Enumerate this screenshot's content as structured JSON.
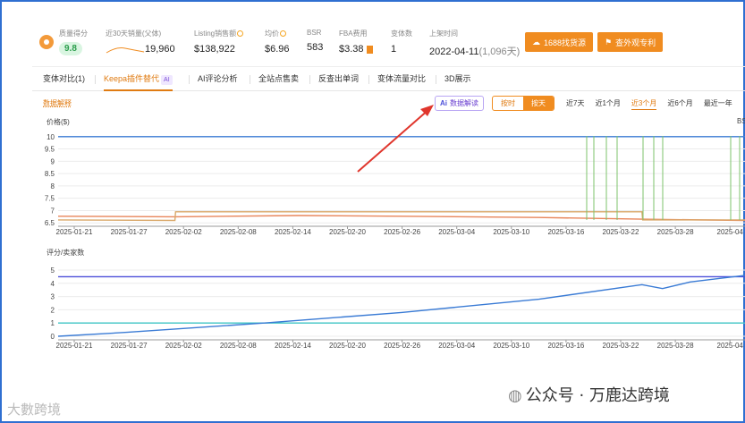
{
  "metrics": {
    "quality": {
      "label": "质量得分",
      "value": "9.8"
    },
    "sales30": {
      "label": "近30天销量(父体)",
      "value": "19,960"
    },
    "listing_sales": {
      "label": "Listing销售额",
      "value": "$138,922"
    },
    "avg_price": {
      "label": "均价",
      "value": "$6.96"
    },
    "bsr": {
      "label": "BSR",
      "value": "583"
    },
    "fba": {
      "label": "FBA费用",
      "value": "$3.38"
    },
    "variants": {
      "label": "变体数",
      "value": "1"
    },
    "launch": {
      "label": "上架时间",
      "value": "2022-04-11",
      "days": "(1,096天)"
    }
  },
  "buttons": {
    "find_source": "1688找货源",
    "patent": "查外观专利"
  },
  "tabs": [
    {
      "label": "变体对比(1)"
    },
    {
      "label": "Keepa插件替代",
      "badge": "AI"
    },
    {
      "label": "AI评论分析"
    },
    {
      "label": "全站点售卖"
    },
    {
      "label": "反查出单词"
    },
    {
      "label": "变体流量对比"
    },
    {
      "label": "3D展示"
    }
  ],
  "toolbar": {
    "interpret_link": "数据解释",
    "ai_button": "数据解读",
    "ai_prefix": "Ai",
    "hourly": "按时",
    "daily": "按天",
    "ranges": [
      "近7天",
      "近1个月",
      "近3个月",
      "近6个月",
      "最近一年"
    ]
  },
  "chart1": {
    "ylabel": "价格($)",
    "right_label": "BS"
  },
  "chart2": {
    "ylabel": "评分/卖家数"
  },
  "watermark": {
    "left": "大數跨境",
    "right": "公众号 · 万鹿达跨境"
  },
  "colors": {
    "accent": "#f08c20",
    "blue": "#3a7bd5",
    "green": "#7cc36b",
    "orange_line": "#e8855a",
    "purple": "#4b4fd9",
    "cyan": "#3ec6c6"
  },
  "chart_data": [
    {
      "type": "line",
      "ylabel": "价格($)",
      "x_ticks": [
        "2025-01-21",
        "2025-01-27",
        "2025-02-02",
        "2025-02-08",
        "2025-02-14",
        "2025-02-20",
        "2025-02-26",
        "2025-03-04",
        "2025-03-10",
        "2025-03-16",
        "2025-03-22",
        "2025-03-28",
        "2025-04"
      ],
      "y_ticks": [
        6.5,
        7,
        7.5,
        8,
        8.5,
        9,
        9.5,
        10
      ],
      "ylim": [
        6.4,
        10.1
      ],
      "series": [
        {
          "color": "#e8855a",
          "points": [
            [
              0,
              6.77
            ],
            [
              0.17,
              6.75
            ],
            [
              0.35,
              6.8
            ],
            [
              0.5,
              6.77
            ],
            [
              0.7,
              6.72
            ],
            [
              0.85,
              6.65
            ],
            [
              1,
              6.6
            ]
          ]
        },
        {
          "color": "#d9a86a",
          "points": [
            [
              0,
              6.62
            ],
            [
              0.17,
              6.6
            ],
            [
              0.171,
              6.95
            ],
            [
              0.85,
              6.95
            ],
            [
              0.851,
              6.62
            ],
            [
              1,
              6.62
            ]
          ]
        },
        {
          "color": "#3a7bd5",
          "points": [
            [
              0,
              10
            ],
            [
              1,
              10
            ]
          ]
        }
      ]
    },
    {
      "type": "line",
      "ylabel": "评分/卖家数",
      "x_ticks": [
        "2025-01-21",
        "2025-01-27",
        "2025-02-02",
        "2025-02-08",
        "2025-02-14",
        "2025-02-20",
        "2025-02-26",
        "2025-03-04",
        "2025-03-10",
        "2025-03-16",
        "2025-03-22",
        "2025-03-28",
        "2025-04"
      ],
      "y_ticks": [
        0,
        1,
        2,
        3,
        4,
        5
      ],
      "ylim": [
        -0.2,
        5.2
      ],
      "series": [
        {
          "color": "#4b4fd9",
          "points": [
            [
              0,
              4.5
            ],
            [
              1,
              4.5
            ]
          ]
        },
        {
          "color": "#3ec6c6",
          "points": [
            [
              0,
              1
            ],
            [
              1,
              1
            ]
          ]
        },
        {
          "color": "#3a7bd5",
          "points": [
            [
              0,
              0
            ],
            [
              0.1,
              0.3
            ],
            [
              0.3,
              1.0
            ],
            [
              0.5,
              1.8
            ],
            [
              0.7,
              2.8
            ],
            [
              0.85,
              3.9
            ],
            [
              0.88,
              3.6
            ],
            [
              0.92,
              4.1
            ],
            [
              1,
              4.6
            ]
          ]
        }
      ]
    }
  ]
}
